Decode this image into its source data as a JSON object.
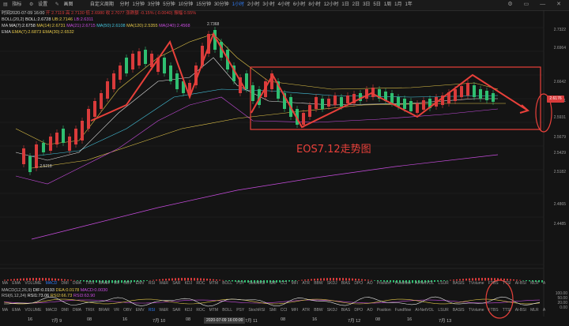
{
  "toolbar": {
    "items": [
      "指标",
      "设置",
      "画图"
    ],
    "timeframes": [
      "分时",
      "1分钟",
      "3分钟",
      "5分钟",
      "10分钟",
      "15分钟",
      "30分钟",
      "1小时",
      "2小时",
      "3小时",
      "4小时",
      "6小时",
      "8小时",
      "12小时",
      "1日",
      "2日",
      "3日",
      "5日",
      "1周",
      "1月",
      "1年"
    ],
    "active_timeframe": "1小时",
    "custom_period": "自定义周期",
    "window_buttons": "⚙ ▭ — ✕"
  },
  "ohlc": {
    "time": "时间2020-07-09 16:00",
    "open": "开 2.7119",
    "high": "高 2.7130",
    "low": "低 2.6980",
    "close": "收 2.7077",
    "change": "涨跌额 -0.15% (-0.0040)",
    "amplitude": "振幅 0.55%"
  },
  "boll": {
    "label": "BOLL(20,2)",
    "boll": "BOLL:2.6728",
    "ub": "UB:2.7146",
    "lb": "LB:2.6311"
  },
  "ma": {
    "label": "MA",
    "ma7": "MA(7):2.6758",
    "ma14": "MA(14):2.6731",
    "ma21": "MA(21):2.6715",
    "ma50": "MA(50):2.6108",
    "ma120": "MA(120):2.5355",
    "ma240": "MA(240):2.4568"
  },
  "ema": {
    "label": "EMA",
    "ema7": "EMA(7):2.6873",
    "ema30": "EMA(30):2.6532"
  },
  "price_axis": [
    "2.7322",
    "2.6964",
    "2.6642",
    "2.6321",
    "2.5931",
    "2.5679",
    "2.5429",
    "2.5182",
    "2.4865",
    "2.4485"
  ],
  "price_axis_lower": [
    "2.4465"
  ],
  "current_price": "2.6176",
  "price_labels": {
    "low": "← 2.5218",
    "high": "2.7368"
  },
  "annotation": "EOS7.12走势图",
  "indicator_row_1": [
    "MA",
    "EMA",
    "VOLUME",
    "MACD",
    "DMI",
    "DMA",
    "TRIX",
    "BRAR",
    "VR",
    "OBV",
    "EMV",
    "RSI",
    "W&R",
    "SAR",
    "KDJ",
    "ROC",
    "MTM",
    "BOLL",
    "PSY",
    "StochRSI",
    "SMI",
    "CCI",
    "MFI",
    "ATR",
    "BBW",
    "SKDJ",
    "BIAS",
    "DPO",
    "AO",
    "Position",
    "Fundflow",
    "Al-NetVOL",
    "LSUR",
    "BASIS",
    "TVolume",
    "FTBS",
    "TTSI",
    "Al-BSI",
    "MLR",
    "Al-PDI",
    "Al-FDI",
    "Al-LI",
    "FR"
  ],
  "indicator_row_1_selected": "MACD",
  "indicator_row_2_selected": "RSI",
  "macd": {
    "label": "MACD(12,26,9)",
    "dif": "DIF:0.0193",
    "dea": "DEA:0.0178",
    "macd": "MACD:0.0030"
  },
  "rsi": {
    "label": "RSI(6,12,24)",
    "rsi1": "RSI1:73.06",
    "rsi2": "RSI2:66.73",
    "rsi3": "RSI3:63.90"
  },
  "rsi_axis": [
    "100.00",
    "50.00",
    "20.00",
    "0.00"
  ],
  "date_axis": [
    "16",
    "7月 9",
    "08",
    "16",
    "7月 10",
    "08",
    "16",
    "7月 11",
    "08",
    "16",
    "7月 12",
    "08",
    "16",
    "7月 13"
  ],
  "crosshair_date": "2020-07-09 16:00:00",
  "colors": {
    "up": "#d93b3b",
    "down": "#2fbf71",
    "annotation": "#e8403a",
    "accent": "#2f7cf6"
  }
}
